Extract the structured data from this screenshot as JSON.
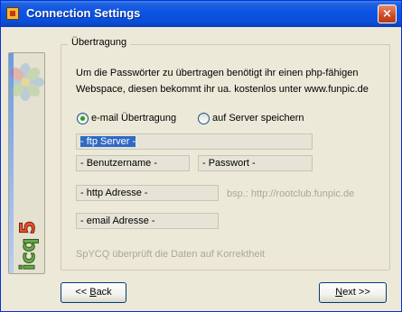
{
  "window": {
    "title": "Connection Settings",
    "close_label": "×"
  },
  "group": {
    "legend": "Übertragung",
    "info_line1": "Um die Passwörter zu übertragen benötigt ihr einen php-fähigen",
    "info_line2": "Webspace, diesen bekommt ihr ua. kostenlos unter  www.funpic.de"
  },
  "radios": {
    "email_label": "e-mail Übertragung",
    "email_checked": true,
    "server_label": "auf Server speichern",
    "server_checked": false
  },
  "fields": {
    "ftp_server": "- ftp Server -",
    "username": "- Benutzername -",
    "password": "- Passwort -",
    "http_address": "- http Adresse -",
    "http_hint": "bsp.: http://rootclub.funpic.de",
    "email_address": "- email Adresse -"
  },
  "status_text": "SpYCQ überprüft die Daten auf Korrektheit",
  "buttons": {
    "back_prefix": "<< ",
    "back_access_key": "B",
    "back_suffix": "ack",
    "next_access_key": "N",
    "next_suffix": "ext >>"
  },
  "branding": {
    "logo_text": "icq5",
    "flower_icon": "icq-flower-icon"
  },
  "colors": {
    "title_bar": "#0a4fd8",
    "radio_dot": "#21a121",
    "selection": "#316ac5",
    "hint_gray": "#aca899"
  }
}
